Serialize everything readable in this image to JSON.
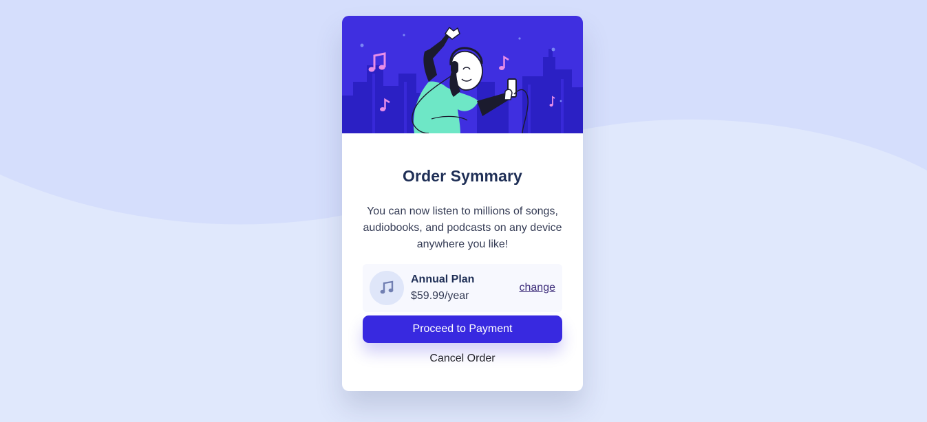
{
  "colors": {
    "page_background": "#e0e8fc",
    "wave_background": "#d5defc",
    "hero_background": "#3f2fe0",
    "primary_button": "#3829e0",
    "title_text": "#1f2f56",
    "change_link": "#3d2d7a"
  },
  "hero": {
    "illustration": "person-dancing-with-headphones-illustration"
  },
  "summary": {
    "title": "Order Symmary",
    "description": "You can now listen to millions of songs, audiobooks, and podcasts on any device anywhere you like!"
  },
  "plan": {
    "icon": "music-note-icon",
    "name": "Annual Plan",
    "price": "$59.99/year",
    "change_label": "change"
  },
  "actions": {
    "proceed_label": "Proceed to Payment",
    "cancel_label": "Cancel Order"
  }
}
